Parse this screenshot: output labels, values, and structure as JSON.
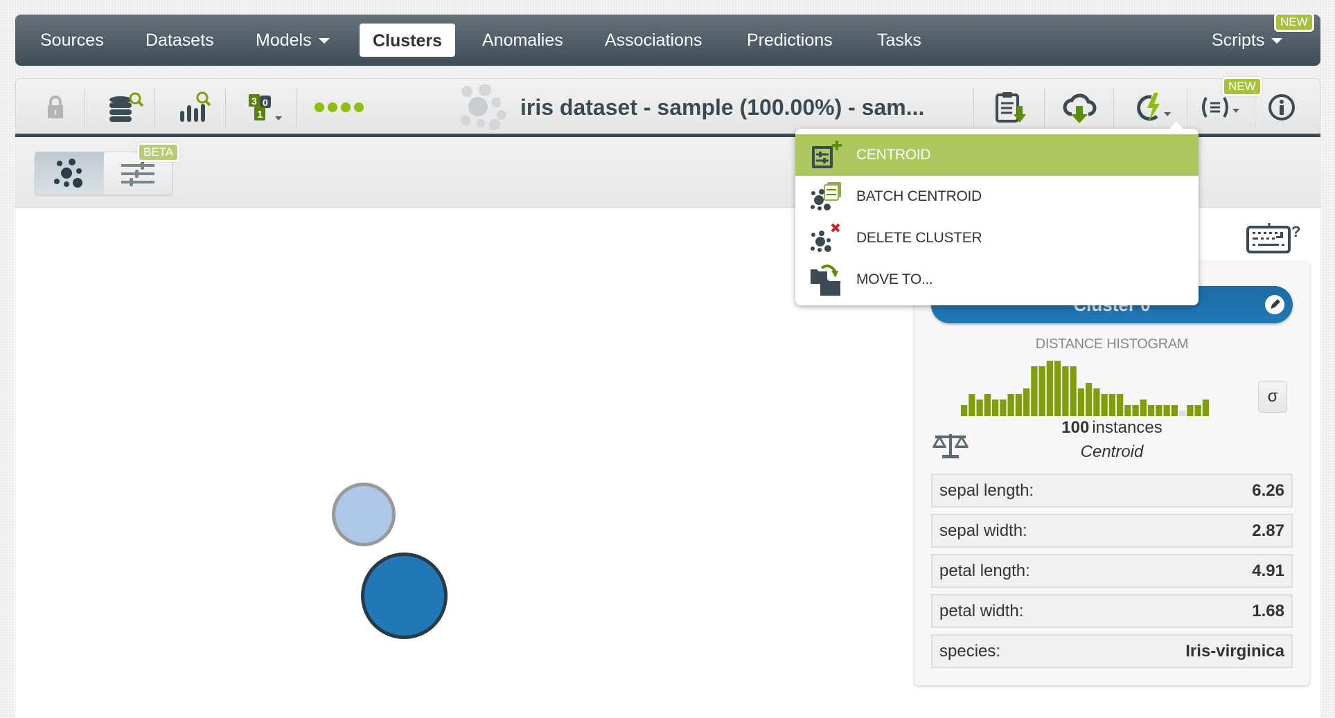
{
  "navbar": {
    "items": [
      {
        "label": "Sources",
        "caret": false
      },
      {
        "label": "Datasets",
        "caret": false
      },
      {
        "label": "Models",
        "caret": true
      },
      {
        "label": "Clusters",
        "active": true
      },
      {
        "label": "Anomalies"
      },
      {
        "label": "Associations"
      },
      {
        "label": "Predictions"
      },
      {
        "label": "Tasks"
      }
    ],
    "scripts_label": "Scripts",
    "scripts_badge": "NEW"
  },
  "toolbar": {
    "title": "iris dataset - sample (100.00%) - sam...",
    "status_dots": 4,
    "new_badge": "NEW",
    "icons": [
      "lock-icon",
      "dataset-search-icon",
      "histogram-search-icon",
      "sort-icon",
      "download-pmml-icon",
      "cloud-download-icon",
      "actions-menu-icon",
      "code-icon",
      "info-icon"
    ]
  },
  "subbar": {
    "beta_badge": "BETA"
  },
  "dropdown": {
    "items": [
      {
        "label": "CENTROID",
        "active": true
      },
      {
        "label": "BATCH CENTROID"
      },
      {
        "label": "DELETE CLUSTER"
      },
      {
        "label": "MOVE TO..."
      }
    ]
  },
  "panel": {
    "cluster_name": "Cluster 0",
    "histogram_title": "DISTANCE HISTOGRAM",
    "sigma_label": "σ",
    "instances_count": "100",
    "instances_label": "instances",
    "centroid_label": "Centroid",
    "attributes": [
      {
        "name": "sepal length:",
        "value": "6.26"
      },
      {
        "name": "sepal width:",
        "value": "2.87"
      },
      {
        "name": "petal length:",
        "value": "4.91"
      },
      {
        "name": "petal width:",
        "value": "1.68"
      },
      {
        "name": "species:",
        "value": "Iris-virginica"
      }
    ]
  },
  "colors": {
    "accent_green": "#adc85e",
    "histogram_bar": "#7f9e07",
    "histogram_empty": "#dddddd",
    "cluster_blue": "#2078b6",
    "cluster_light": "#aec7e8",
    "nav_dark": "#3f4d57"
  },
  "chart_data": {
    "type": "bar",
    "title": "DISTANCE HISTOGRAM",
    "values": [
      2,
      4,
      3,
      4,
      3,
      3,
      4,
      4,
      5,
      9,
      9,
      10,
      10,
      9,
      9,
      5,
      6,
      5,
      4,
      4,
      4,
      2,
      2,
      3,
      2,
      2,
      2,
      2,
      1,
      2,
      2,
      3
    ],
    "highlight_empty_index": 28,
    "xlabel": "",
    "ylabel": ""
  },
  "clusters_map": [
    {
      "name": "cluster-node-light",
      "fill": "#aec7e8",
      "stroke": "#999999",
      "selected": false
    },
    {
      "name": "cluster-node-selected",
      "fill": "#2078b6",
      "stroke": "#283a45",
      "selected": true
    }
  ]
}
